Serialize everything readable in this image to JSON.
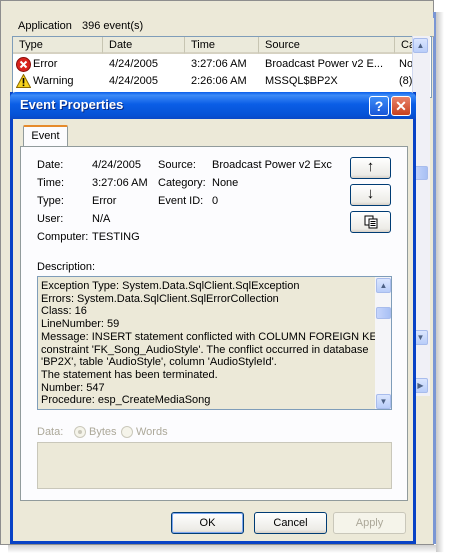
{
  "background": {
    "status": {
      "scope": "Application",
      "count": "396 event(s)"
    },
    "columns": [
      "Type",
      "Date",
      "Time",
      "Source",
      "Ca"
    ],
    "rows": [
      {
        "type": "Error",
        "date": "4/24/2005",
        "time": "3:27:06 AM",
        "source": "Broadcast Power v2 E...",
        "category": "No"
      },
      {
        "type": "Warning",
        "date": "4/24/2005",
        "time": "2:26:06 AM",
        "source": "MSSQL$BP2X",
        "category": "(8)"
      }
    ]
  },
  "dialog": {
    "title": "Event Properties",
    "help_label": "?",
    "close_label": "✕",
    "tab": "Event",
    "fields": {
      "date_label": "Date:",
      "date_value": "4/24/2005",
      "time_label": "Time:",
      "time_value": "3:27:06 AM",
      "type_label": "Type:",
      "type_value": "Error",
      "user_label": "User:",
      "user_value": "N/A",
      "computer_label": "Computer:",
      "computer_value": "TESTING",
      "source_label": "Source:",
      "source_value": "Broadcast Power v2 Exc",
      "category_label": "Category:",
      "category_value": "None",
      "eventid_label": "Event ID:",
      "eventid_value": "0"
    },
    "nav": {
      "up": "↑",
      "down": "↓"
    },
    "description_label": "Description:",
    "description_lines": [
      "Exception Type: System.Data.SqlClient.SqlException",
      "Errors: System.Data.SqlClient.SqlErrorCollection",
      "Class: 16",
      "LineNumber: 59",
      "Message: INSERT statement conflicted with COLUMN FOREIGN KEY",
      "constraint 'FK_Song_AudioStyle'. The conflict occurred in database",
      "'BP2X', table 'AudioStyle', column 'AudioStyleId'.",
      "The statement has been terminated.",
      "Number: 547",
      "Procedure: esp_CreateMediaSong"
    ],
    "data": {
      "label": "Data:",
      "bytes": "Bytes",
      "words": "Words"
    },
    "buttons": {
      "ok": "OK",
      "cancel": "Cancel",
      "apply": "Apply"
    }
  }
}
